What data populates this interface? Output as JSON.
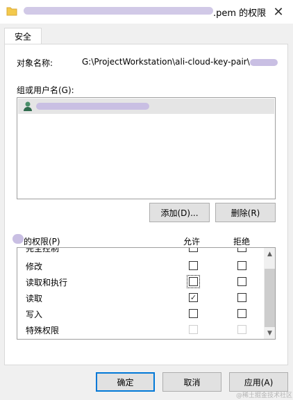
{
  "title": {
    "suffix": ".pem 的权限",
    "close_glyph": "✕"
  },
  "tabs": [
    {
      "label": "安全"
    }
  ],
  "object": {
    "label": "对象名称:",
    "value": "G:\\ProjectWorkstation\\ali-cloud-key-pair\\"
  },
  "groups": {
    "label": "组或用户名(G):"
  },
  "buttons": {
    "add": "添加(D)...",
    "remove": "删除(R)",
    "ok": "确定",
    "cancel": "取消",
    "apply": "应用(A)"
  },
  "permissions": {
    "label": "的权限(P)",
    "col_allow": "允许",
    "col_deny": "拒绝",
    "rows": [
      {
        "name": "完全控制",
        "allow": false,
        "deny": false,
        "disabled": false
      },
      {
        "name": "修改",
        "allow": false,
        "deny": false,
        "disabled": false
      },
      {
        "name": "读取和执行",
        "allow": false,
        "deny": false,
        "disabled": false,
        "focused": true
      },
      {
        "name": "读取",
        "allow": true,
        "deny": false,
        "disabled": false
      },
      {
        "name": "写入",
        "allow": false,
        "deny": false,
        "disabled": false
      },
      {
        "name": "特殊权限",
        "allow": false,
        "deny": false,
        "disabled": true
      }
    ],
    "check_glyph": "✓"
  },
  "scrollbar": {
    "up_glyph": "▲",
    "down_glyph": "▼"
  },
  "watermark": "@稀土掘金技术社区",
  "colors": {
    "accent": "#0078d7",
    "selected_row": "#e5e5e5",
    "redaction": "#c9bfe3"
  }
}
